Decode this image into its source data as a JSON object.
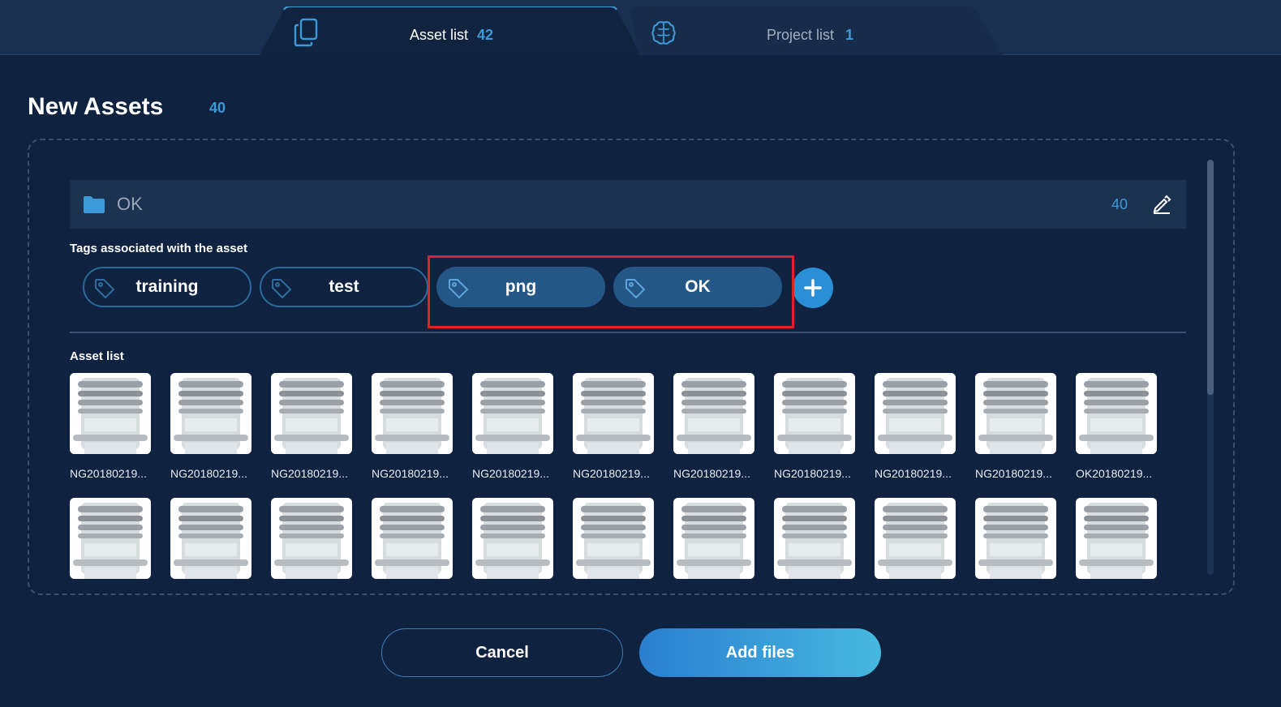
{
  "tabs": [
    {
      "label": "Asset list",
      "count": "42",
      "active": true,
      "icon": "copy-icon"
    },
    {
      "label": "Project list",
      "count": "1",
      "active": false,
      "icon": "brain-icon"
    }
  ],
  "page": {
    "title": "New Assets",
    "count": "40"
  },
  "folder": {
    "name": "OK",
    "count": "40",
    "icon": "folder-icon",
    "edit_icon": "pencil-icon"
  },
  "tags_section": {
    "label": "Tags associated with the asset"
  },
  "tags": [
    {
      "label": "training",
      "style": "outline"
    },
    {
      "label": "test",
      "style": "outline"
    },
    {
      "label": "png",
      "style": "filled"
    },
    {
      "label": "OK",
      "style": "filled"
    }
  ],
  "asset_section": {
    "label": "Asset list"
  },
  "assets": [
    {
      "name": "NG20180219..."
    },
    {
      "name": "NG20180219..."
    },
    {
      "name": "NG20180219..."
    },
    {
      "name": "NG20180219..."
    },
    {
      "name": "NG20180219..."
    },
    {
      "name": "NG20180219..."
    },
    {
      "name": "NG20180219..."
    },
    {
      "name": "NG20180219..."
    },
    {
      "name": "NG20180219..."
    },
    {
      "name": "NG20180219..."
    },
    {
      "name": "OK20180219..."
    }
  ],
  "buttons": {
    "cancel": "Cancel",
    "add_files": "Add files"
  },
  "colors": {
    "background": "#0f2340",
    "accent": "#3d9ad8",
    "highlight": "#e0202a",
    "tag_filled": "#245686"
  }
}
